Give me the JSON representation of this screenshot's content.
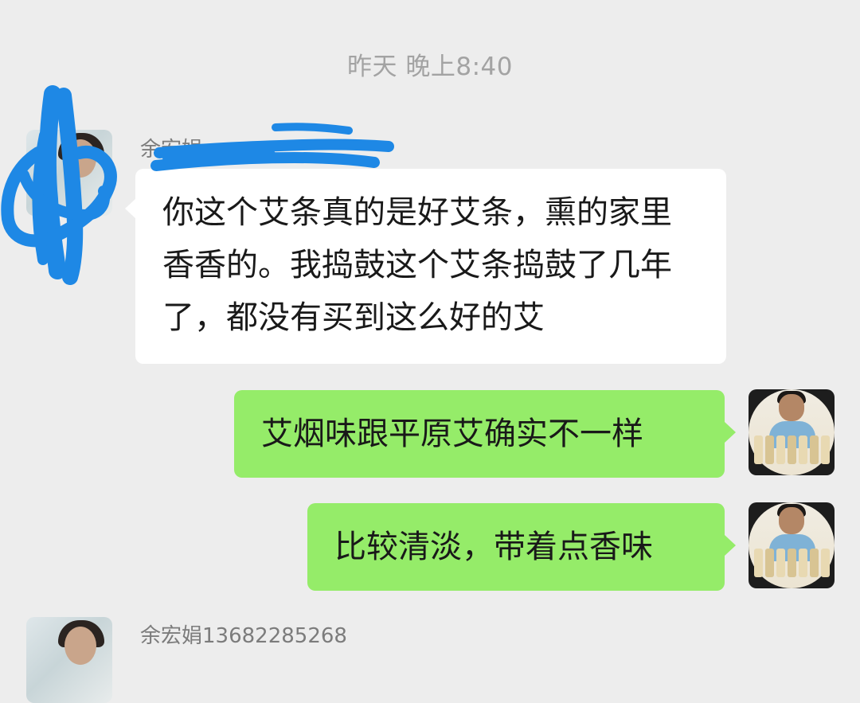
{
  "chat": {
    "timestamp": "昨天 晚上8:40",
    "messages": [
      {
        "side": "left",
        "sender_name": "余宏娟",
        "text": "你这个艾条真的是好艾条，熏的家里香香的。我捣鼓这个艾条捣鼓了几年了，都没有买到这么好的艾"
      },
      {
        "side": "right",
        "text": "艾烟味跟平原艾确实不一样"
      },
      {
        "side": "right",
        "text": "比较清淡，带着点香味"
      },
      {
        "side": "left",
        "sender_name": "余宏娟13682285268"
      }
    ]
  },
  "colors": {
    "background": "#ededed",
    "incoming_bubble": "#ffffff",
    "outgoing_bubble": "#95ec69",
    "redaction_scribble": "#1e88e5"
  },
  "icons": {
    "left_avatar": "contact-avatar-photo",
    "right_avatar": "own-avatar-photo"
  }
}
